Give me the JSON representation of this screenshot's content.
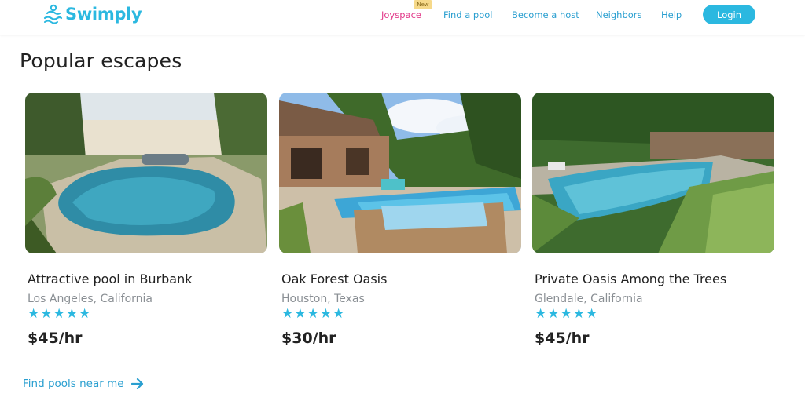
{
  "brand": {
    "name": "Swimply",
    "icon": "swimmer-logo-icon",
    "color": "#2bb8e0"
  },
  "nav": {
    "joyspace": "Joyspace",
    "joyspace_badge": "New",
    "find_pool": "Find a pool",
    "become_host": "Become a host",
    "neighbors": "Neighbors",
    "help": "Help",
    "login": "Login"
  },
  "section": {
    "title": "Popular escapes"
  },
  "cards": [
    {
      "title": "Attractive pool in Burbank",
      "location": "Los Angeles, California",
      "stars": "★★★★★",
      "rating": 5,
      "price": "$45/hr"
    },
    {
      "title": "Oak Forest Oasis",
      "location": "Houston, Texas",
      "stars": "★★★★★",
      "rating": 5,
      "price": "$30/hr"
    },
    {
      "title": "Private Oasis Among the Trees",
      "location": "Glendale, California",
      "stars": "★★★★★",
      "rating": 5,
      "price": "$45/hr"
    }
  ],
  "footer": {
    "find_pools": "Find pools near me",
    "icon": "arrow-right-icon"
  },
  "colors": {
    "accent": "#2bb8e0",
    "link": "#2a9fd0",
    "joyspace": "#e23a8a",
    "badge": "#f6d98a"
  }
}
